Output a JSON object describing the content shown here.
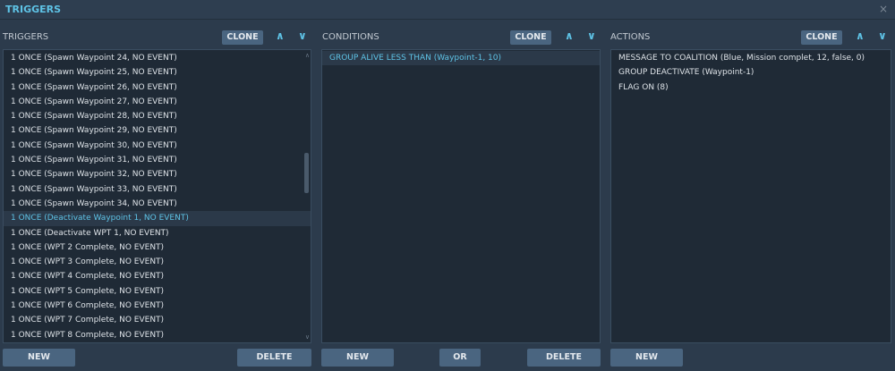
{
  "window": {
    "title": "TRIGGERS",
    "close": "×"
  },
  "triggers": {
    "header": "TRIGGERS",
    "clone": "CLONE",
    "up": "︿",
    "down": "﹀",
    "items": [
      "1 ONCE (Spawn Waypoint 24, NO EVENT)",
      "1 ONCE (Spawn Waypoint 25, NO EVENT)",
      "1 ONCE (Spawn Waypoint 26, NO EVENT)",
      "1 ONCE (Spawn Waypoint 27, NO EVENT)",
      "1 ONCE (Spawn Waypoint 28, NO EVENT)",
      "1 ONCE (Spawn Waypoint 29, NO EVENT)",
      "1 ONCE (Spawn Waypoint 30, NO EVENT)",
      "1 ONCE (Spawn Waypoint 31, NO EVENT)",
      "1 ONCE (Spawn Waypoint 32, NO EVENT)",
      "1 ONCE (Spawn Waypoint 33, NO EVENT)",
      "1 ONCE (Spawn Waypoint 34, NO EVENT)",
      "1 ONCE (Deactivate Waypoint 1, NO EVENT)",
      "1 ONCE (Deactivate WPT 1, NO EVENT)",
      "1 ONCE (WPT 2 Complete, NO EVENT)",
      "1 ONCE (WPT 3 Complete, NO EVENT)",
      "1 ONCE (WPT 4 Complete, NO EVENT)",
      "1 ONCE (WPT 5 Complete, NO EVENT)",
      "1 ONCE (WPT 6 Complete, NO EVENT)",
      "1 ONCE (WPT 7 Complete, NO EVENT)",
      "1 ONCE (WPT 8 Complete, NO EVENT)"
    ],
    "selected_index": 11,
    "new": "NEW",
    "delete": "DELETE"
  },
  "conditions": {
    "header": "CONDITIONS",
    "clone": "CLONE",
    "items": [
      "GROUP ALIVE LESS THAN (Waypoint-1, 10)"
    ],
    "new": "NEW",
    "or": "OR",
    "delete": "DELETE"
  },
  "actions": {
    "header": "ACTIONS",
    "clone": "CLONE",
    "items": [
      "MESSAGE TO COALITION (Blue, Mission complet, 12, false, 0)",
      "GROUP DEACTIVATE (Waypoint-1)",
      "FLAG ON (8)"
    ],
    "new": "NEW"
  }
}
